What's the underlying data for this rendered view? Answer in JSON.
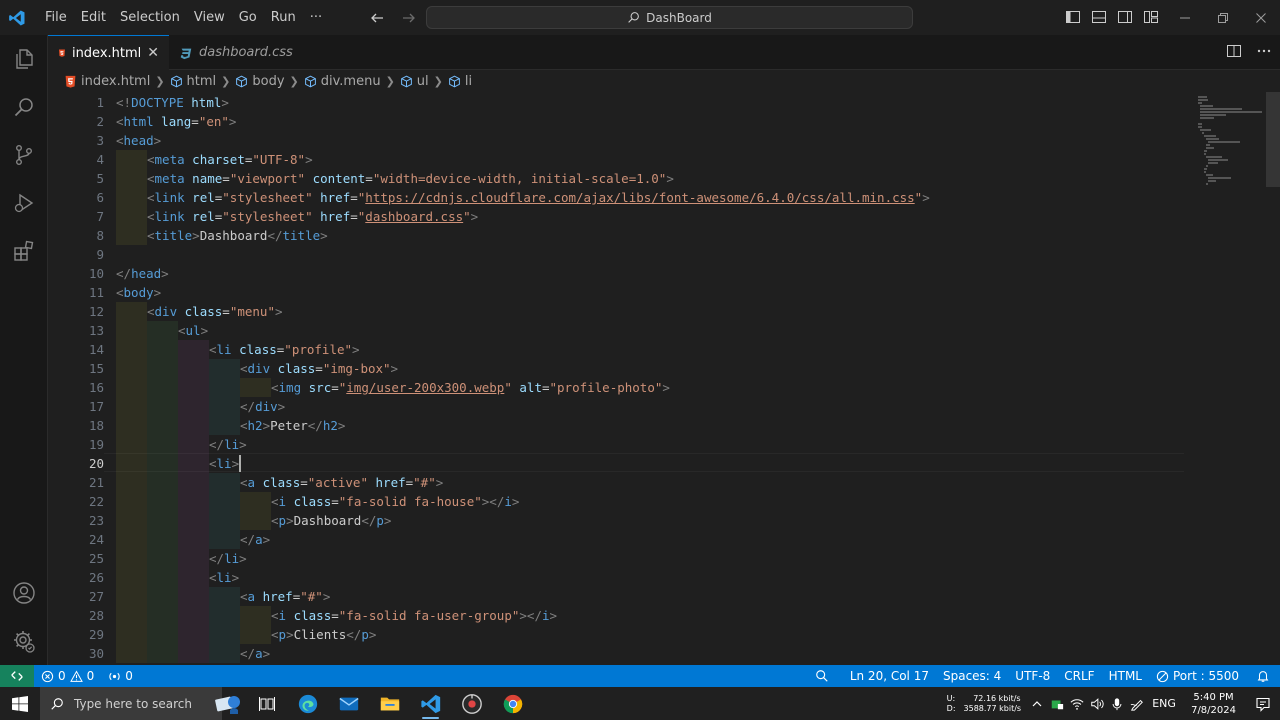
{
  "titlebar": {
    "menu": [
      "File",
      "Edit",
      "Selection",
      "View",
      "Go",
      "Run",
      "···"
    ],
    "command_center": "DashBoard"
  },
  "tabs": [
    {
      "label": "index.html",
      "active": true
    },
    {
      "label": "dashboard.css",
      "active": false
    }
  ],
  "breadcrumb": [
    "index.html",
    "html",
    "body",
    "div.menu",
    "ul",
    "li"
  ],
  "editor": {
    "line_numbers": [
      "1",
      "2",
      "3",
      "4",
      "5",
      "6",
      "7",
      "8",
      "9",
      "10",
      "11",
      "12",
      "13",
      "14",
      "15",
      "16",
      "17",
      "18",
      "19",
      "20",
      "21",
      "22",
      "23",
      "24",
      "25",
      "26",
      "27",
      "28",
      "29",
      "30"
    ],
    "current_line": "20",
    "lines": [
      {
        "indent": 0,
        "tokens": [
          [
            "p",
            "<!"
          ],
          [
            "t",
            "DOCTYPE"
          ],
          [
            "x",
            " "
          ],
          [
            "a",
            "html"
          ],
          [
            "p",
            ">"
          ]
        ]
      },
      {
        "indent": 0,
        "tokens": [
          [
            "p",
            "<"
          ],
          [
            "t",
            "html"
          ],
          [
            "x",
            " "
          ],
          [
            "a",
            "lang"
          ],
          [
            "x",
            "="
          ],
          [
            "s",
            "\"en\""
          ],
          [
            "p",
            ">"
          ]
        ]
      },
      {
        "indent": 0,
        "tokens": [
          [
            "p",
            "<"
          ],
          [
            "t",
            "head"
          ],
          [
            "p",
            ">"
          ]
        ]
      },
      {
        "indent": 1,
        "tokens": [
          [
            "p",
            "<"
          ],
          [
            "t",
            "meta"
          ],
          [
            "x",
            " "
          ],
          [
            "a",
            "charset"
          ],
          [
            "x",
            "="
          ],
          [
            "s",
            "\"UTF-8\""
          ],
          [
            "p",
            ">"
          ]
        ]
      },
      {
        "indent": 1,
        "tokens": [
          [
            "p",
            "<"
          ],
          [
            "t",
            "meta"
          ],
          [
            "x",
            " "
          ],
          [
            "a",
            "name"
          ],
          [
            "x",
            "="
          ],
          [
            "s",
            "\"viewport\""
          ],
          [
            "x",
            " "
          ],
          [
            "a",
            "content"
          ],
          [
            "x",
            "="
          ],
          [
            "s",
            "\"width=device-width, initial-scale=1.0\""
          ],
          [
            "p",
            ">"
          ]
        ]
      },
      {
        "indent": 1,
        "tokens": [
          [
            "p",
            "<"
          ],
          [
            "t",
            "link"
          ],
          [
            "x",
            " "
          ],
          [
            "a",
            "rel"
          ],
          [
            "x",
            "="
          ],
          [
            "s",
            "\"stylesheet\""
          ],
          [
            "x",
            " "
          ],
          [
            "a",
            "href"
          ],
          [
            "x",
            "="
          ],
          [
            "s",
            "\""
          ],
          [
            "l",
            "https://cdnjs.cloudflare.com/ajax/libs/font-awesome/6.4.0/css/all.min.css"
          ],
          [
            "s",
            "\""
          ],
          [
            "p",
            ">"
          ]
        ]
      },
      {
        "indent": 1,
        "tokens": [
          [
            "p",
            "<"
          ],
          [
            "t",
            "link"
          ],
          [
            "x",
            " "
          ],
          [
            "a",
            "rel"
          ],
          [
            "x",
            "="
          ],
          [
            "s",
            "\"stylesheet\""
          ],
          [
            "x",
            " "
          ],
          [
            "a",
            "href"
          ],
          [
            "x",
            "="
          ],
          [
            "s",
            "\""
          ],
          [
            "l",
            "dashboard.css"
          ],
          [
            "s",
            "\""
          ],
          [
            "p",
            ">"
          ]
        ]
      },
      {
        "indent": 1,
        "tokens": [
          [
            "p",
            "<"
          ],
          [
            "t",
            "title"
          ],
          [
            "p",
            ">"
          ],
          [
            "x",
            "Dashboard"
          ],
          [
            "p",
            "</"
          ],
          [
            "t",
            "title"
          ],
          [
            "p",
            ">"
          ]
        ]
      },
      {
        "indent": 0,
        "tokens": []
      },
      {
        "indent": 0,
        "tokens": [
          [
            "p",
            "</"
          ],
          [
            "t",
            "head"
          ],
          [
            "p",
            ">"
          ]
        ]
      },
      {
        "indent": 0,
        "tokens": [
          [
            "p",
            "<"
          ],
          [
            "t",
            "body"
          ],
          [
            "p",
            ">"
          ]
        ]
      },
      {
        "indent": 1,
        "tokens": [
          [
            "p",
            "<"
          ],
          [
            "t",
            "div"
          ],
          [
            "x",
            " "
          ],
          [
            "a",
            "class"
          ],
          [
            "x",
            "="
          ],
          [
            "s",
            "\"menu\""
          ],
          [
            "p",
            ">"
          ]
        ]
      },
      {
        "indent": 2,
        "tokens": [
          [
            "p",
            "<"
          ],
          [
            "t",
            "ul"
          ],
          [
            "p",
            ">"
          ]
        ]
      },
      {
        "indent": 3,
        "tokens": [
          [
            "p",
            "<"
          ],
          [
            "t",
            "li"
          ],
          [
            "x",
            " "
          ],
          [
            "a",
            "class"
          ],
          [
            "x",
            "="
          ],
          [
            "s",
            "\"profile\""
          ],
          [
            "p",
            ">"
          ]
        ]
      },
      {
        "indent": 4,
        "tokens": [
          [
            "p",
            "<"
          ],
          [
            "t",
            "div"
          ],
          [
            "x",
            " "
          ],
          [
            "a",
            "class"
          ],
          [
            "x",
            "="
          ],
          [
            "s",
            "\"img-box\""
          ],
          [
            "p",
            ">"
          ]
        ]
      },
      {
        "indent": 5,
        "tokens": [
          [
            "p",
            "<"
          ],
          [
            "t",
            "img"
          ],
          [
            "x",
            " "
          ],
          [
            "a",
            "src"
          ],
          [
            "x",
            "="
          ],
          [
            "s",
            "\""
          ],
          [
            "l",
            "img/user-200x300.webp"
          ],
          [
            "s",
            "\""
          ],
          [
            "x",
            " "
          ],
          [
            "a",
            "alt"
          ],
          [
            "x",
            "="
          ],
          [
            "s",
            "\"profile-photo\""
          ],
          [
            "p",
            ">"
          ]
        ]
      },
      {
        "indent": 4,
        "tokens": [
          [
            "p",
            "</"
          ],
          [
            "t",
            "div"
          ],
          [
            "p",
            ">"
          ]
        ]
      },
      {
        "indent": 4,
        "tokens": [
          [
            "p",
            "<"
          ],
          [
            "t",
            "h2"
          ],
          [
            "p",
            ">"
          ],
          [
            "x",
            "Peter"
          ],
          [
            "p",
            "</"
          ],
          [
            "t",
            "h2"
          ],
          [
            "p",
            ">"
          ]
        ]
      },
      {
        "indent": 3,
        "tokens": [
          [
            "p",
            "</"
          ],
          [
            "t",
            "li"
          ],
          [
            "p",
            ">"
          ]
        ]
      },
      {
        "indent": 3,
        "tokens": [
          [
            "p",
            "<"
          ],
          [
            "t",
            "li"
          ],
          [
            "p",
            ">"
          ]
        ]
      },
      {
        "indent": 4,
        "tokens": [
          [
            "p",
            "<"
          ],
          [
            "t",
            "a"
          ],
          [
            "x",
            " "
          ],
          [
            "a",
            "class"
          ],
          [
            "x",
            "="
          ],
          [
            "s",
            "\"active\""
          ],
          [
            "x",
            " "
          ],
          [
            "a",
            "href"
          ],
          [
            "x",
            "="
          ],
          [
            "s",
            "\"#\""
          ],
          [
            "p",
            ">"
          ]
        ]
      },
      {
        "indent": 5,
        "tokens": [
          [
            "p",
            "<"
          ],
          [
            "t",
            "i"
          ],
          [
            "x",
            " "
          ],
          [
            "a",
            "class"
          ],
          [
            "x",
            "="
          ],
          [
            "s",
            "\"fa-solid fa-house\""
          ],
          [
            "p",
            ">"
          ],
          [
            "p",
            "</"
          ],
          [
            "t",
            "i"
          ],
          [
            "p",
            ">"
          ]
        ]
      },
      {
        "indent": 5,
        "tokens": [
          [
            "p",
            "<"
          ],
          [
            "t",
            "p"
          ],
          [
            "p",
            ">"
          ],
          [
            "x",
            "Dashboard"
          ],
          [
            "p",
            "</"
          ],
          [
            "t",
            "p"
          ],
          [
            "p",
            ">"
          ]
        ]
      },
      {
        "indent": 4,
        "tokens": [
          [
            "p",
            "</"
          ],
          [
            "t",
            "a"
          ],
          [
            "p",
            ">"
          ]
        ]
      },
      {
        "indent": 3,
        "tokens": [
          [
            "p",
            "</"
          ],
          [
            "t",
            "li"
          ],
          [
            "p",
            ">"
          ]
        ]
      },
      {
        "indent": 3,
        "tokens": [
          [
            "p",
            "<"
          ],
          [
            "t",
            "li"
          ],
          [
            "p",
            ">"
          ]
        ]
      },
      {
        "indent": 4,
        "tokens": [
          [
            "p",
            "<"
          ],
          [
            "t",
            "a"
          ],
          [
            "x",
            " "
          ],
          [
            "a",
            "href"
          ],
          [
            "x",
            "="
          ],
          [
            "s",
            "\"#\""
          ],
          [
            "p",
            ">"
          ]
        ]
      },
      {
        "indent": 5,
        "tokens": [
          [
            "p",
            "<"
          ],
          [
            "t",
            "i"
          ],
          [
            "x",
            " "
          ],
          [
            "a",
            "class"
          ],
          [
            "x",
            "="
          ],
          [
            "s",
            "\"fa-solid fa-user-group\""
          ],
          [
            "p",
            ">"
          ],
          [
            "p",
            "</"
          ],
          [
            "t",
            "i"
          ],
          [
            "p",
            ">"
          ]
        ]
      },
      {
        "indent": 5,
        "tokens": [
          [
            "p",
            "<"
          ],
          [
            "t",
            "p"
          ],
          [
            "p",
            ">"
          ],
          [
            "x",
            "Clients"
          ],
          [
            "p",
            "</"
          ],
          [
            "t",
            "p"
          ],
          [
            "p",
            ">"
          ]
        ]
      },
      {
        "indent": 4,
        "tokens": [
          [
            "p",
            "</"
          ],
          [
            "t",
            "a"
          ],
          [
            "p",
            ">"
          ]
        ]
      }
    ]
  },
  "statusbar": {
    "errors": "0",
    "warnings": "0",
    "ports_count": "0",
    "position": "Ln 20, Col 17",
    "spaces": "Spaces: 4",
    "encoding": "UTF-8",
    "eol": "CRLF",
    "language": "HTML",
    "port": "Port : 5500"
  },
  "taskbar": {
    "search_placeholder": "Type here to search",
    "upload_label": "U:",
    "upload_speed": "72.16 kbit/s",
    "download_label": "D:",
    "download_speed": "3588.77 kbit/s",
    "language": "ENG",
    "time": "5:40 PM",
    "date": "7/8/2024"
  },
  "colors": {
    "accent": "#0078d4",
    "tag": "#569cd6",
    "attribute": "#9cdcfe",
    "string": "#ce9178",
    "remote": "#16825d"
  }
}
